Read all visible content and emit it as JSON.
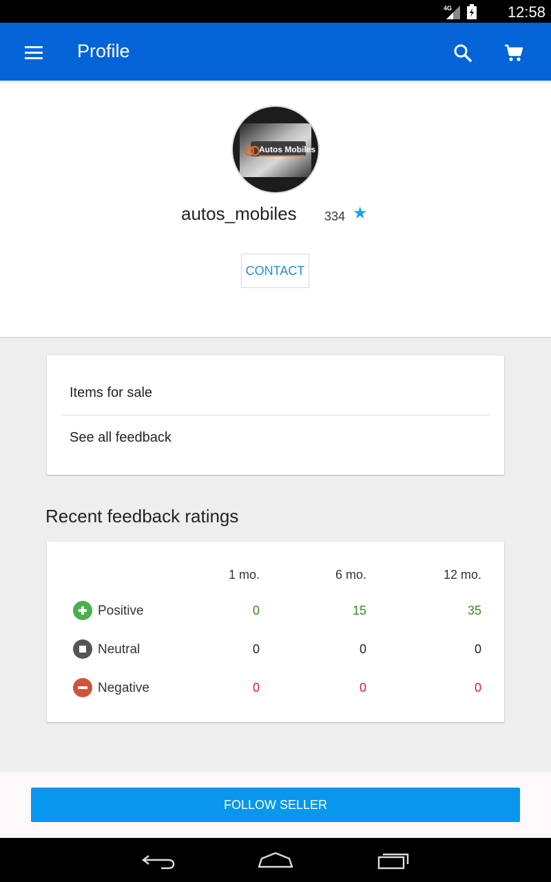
{
  "status_bar": {
    "time": "12:58",
    "network": "4G",
    "icons": [
      "signal-icon",
      "battery-icon"
    ]
  },
  "app_bar": {
    "title": "Profile",
    "icons": [
      "menu-icon",
      "search-icon",
      "cart-icon"
    ],
    "color": "#0364d8"
  },
  "profile": {
    "avatar_logo": "Autos Mobiles",
    "username": "autos_mobiles",
    "score": "334",
    "star": "★",
    "contact_label": "CONTACT"
  },
  "links": [
    {
      "label": "Items for sale"
    },
    {
      "label": "See all feedback"
    }
  ],
  "feedback": {
    "title": "Recent feedback ratings",
    "columns": [
      "1 mo.",
      "6 mo.",
      "12 mo."
    ],
    "rows": [
      {
        "label": "Positive",
        "values": [
          "0",
          "15",
          "35"
        ],
        "color": "#3a8a1c",
        "icon": "plus-icon",
        "icon_color": "#4caf50"
      },
      {
        "label": "Neutral",
        "values": [
          "0",
          "0",
          "0"
        ],
        "color": "#222222",
        "icon": "square-icon",
        "icon_color": "#555555"
      },
      {
        "label": "Negative",
        "values": [
          "0",
          "0",
          "0"
        ],
        "color": "#d0202a",
        "icon": "minus-icon",
        "icon_color": "#d0533b"
      }
    ]
  },
  "footer": {
    "follow_label": "FOLLOW SELLER",
    "color": "#0897ec"
  },
  "nav_bar": {
    "icons": [
      "back-icon",
      "home-icon",
      "recents-icon"
    ]
  }
}
